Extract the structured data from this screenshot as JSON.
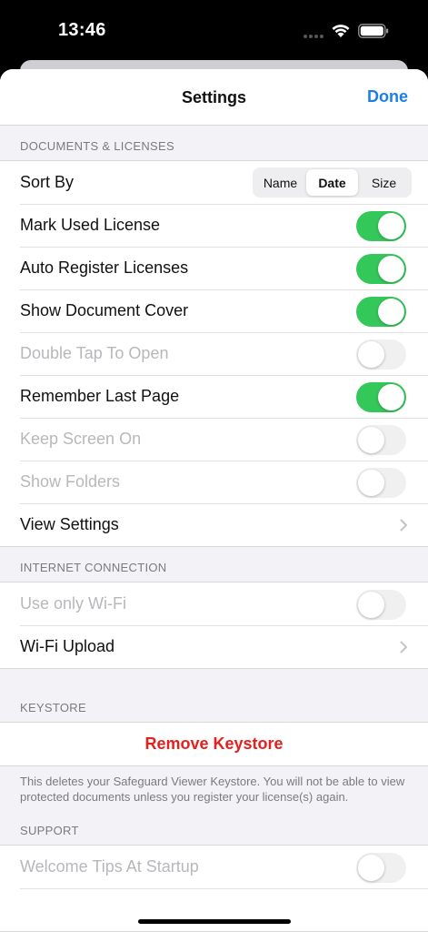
{
  "status_bar": {
    "time": "13:46"
  },
  "nav": {
    "title": "Settings",
    "done_label": "Done"
  },
  "sections": {
    "documents": {
      "header": "DOCUMENTS & LICENSES",
      "sort_by": {
        "label": "Sort By",
        "options": [
          "Name",
          "Date",
          "Size"
        ],
        "selected": "Date"
      },
      "mark_used": {
        "label": "Mark Used License",
        "on": true
      },
      "auto_register": {
        "label": "Auto Register Licenses",
        "on": true
      },
      "show_cover": {
        "label": "Show Document Cover",
        "on": true
      },
      "double_tap": {
        "label": "Double Tap To Open",
        "on": false,
        "disabled": true
      },
      "remember_page": {
        "label": "Remember Last Page",
        "on": true
      },
      "keep_screen": {
        "label": "Keep Screen On",
        "on": false,
        "disabled": true
      },
      "show_folders": {
        "label": "Show Folders",
        "on": false,
        "disabled": true
      },
      "view_settings": {
        "label": "View Settings"
      }
    },
    "internet": {
      "header": "INTERNET CONNECTION",
      "wifi_only": {
        "label": "Use only Wi-Fi",
        "on": false,
        "disabled": true
      },
      "wifi_upload": {
        "label": "Wi-Fi Upload"
      }
    },
    "keystore": {
      "header": "KEYSTORE",
      "remove_label": "Remove Keystore",
      "footer": "This deletes your Safeguard Viewer Keystore. You will not be able to view protected documents unless you register your license(s) again."
    },
    "support": {
      "header": "SUPPORT",
      "welcome_tips": {
        "label": "Welcome Tips At Startup",
        "on": false,
        "disabled": true
      }
    }
  },
  "colors": {
    "accent": "#1c7fe8",
    "toggle_on": "#34c759",
    "destructive": "#e5201e"
  }
}
